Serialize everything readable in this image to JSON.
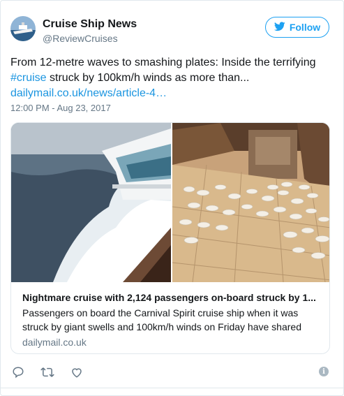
{
  "author": {
    "name": "Cruise Ship News",
    "handle": "@ReviewCruises",
    "avatar_icon": "cruise-ship-avatar"
  },
  "follow_button": {
    "label": "Follow",
    "icon": "twitter-bird-icon",
    "color": "#1da1f2"
  },
  "tweet": {
    "text_part1": "From 12-metre waves to smashing plates: Inside the terrifying",
    "hashtag": "#cruise",
    "text_part2": " struck by 100km/h winds as more than...",
    "link": "dailymail.co.uk/news/article-4…",
    "timestamp": "12:00 PM - Aug 23, 2017"
  },
  "card": {
    "title": "Nightmare cruise with 2,124 passengers on-board struck by 1...",
    "description": "Passengers on board the Carnival Spirit cruise ship when it was struck by giant swells and 100km/h winds on Friday have shared",
    "domain": "dailymail.co.uk",
    "image_left": "ship-deck-waves-photo",
    "image_right": "smashed-plates-floor-photo"
  },
  "actions": {
    "icons": [
      "reply-icon",
      "retweet-icon",
      "like-icon"
    ],
    "info_icon": "info-icon",
    "info_glyph": "i"
  },
  "colors": {
    "link": "#1b95e0",
    "secondary": "#657786",
    "border": "#e1e8ed"
  }
}
